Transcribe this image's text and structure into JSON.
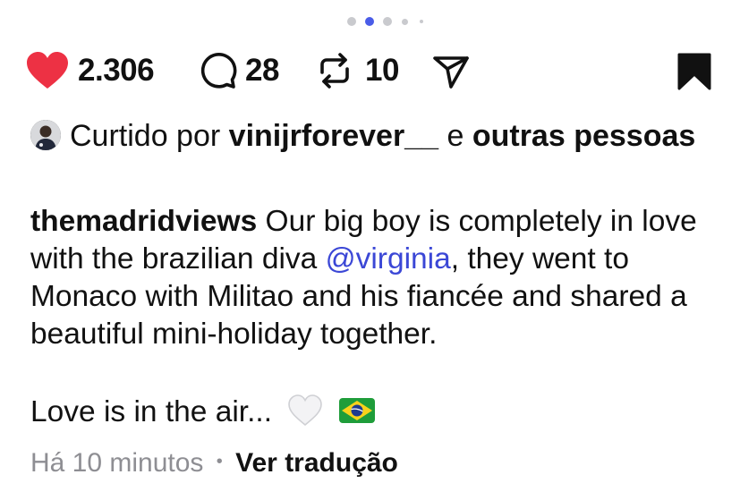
{
  "carousel": {
    "total": 5,
    "active": 2
  },
  "actions": {
    "likes": "2.306",
    "comments": "28",
    "reposts": "10",
    "like_color": "#ed3144"
  },
  "liked_by": {
    "prefix": "Curtido por",
    "user": "vinijrforever__",
    "conj": "e",
    "others": "outras pessoas"
  },
  "post": {
    "username": "themadridviews",
    "caption_before": "Our big boy is completely in love with the brazilian diva",
    "mention": "@virginia",
    "caption_after": ", they went to Monaco with Militao and his fiancée and shared a beautiful mini-holiday together.",
    "line2": "Love is in the air..."
  },
  "meta": {
    "time": "Há 10 minutos",
    "separator": "•",
    "translate": "Ver tradução"
  }
}
